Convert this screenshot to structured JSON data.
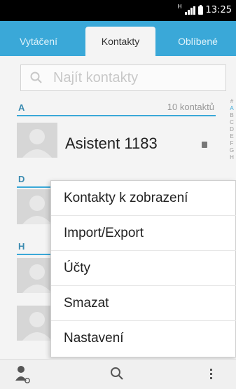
{
  "status_bar": {
    "network": "H",
    "time": "13:25"
  },
  "tabs": [
    {
      "label": "Vytáčení",
      "active": false
    },
    {
      "label": "Kontakty",
      "active": true
    },
    {
      "label": "Oblíbené",
      "active": false
    }
  ],
  "search": {
    "placeholder": "Najít kontakty",
    "icon": "search-icon"
  },
  "sections": [
    {
      "letter": "A",
      "count": "10 kontaktů"
    },
    {
      "letter": "D",
      "count": ""
    },
    {
      "letter": "H",
      "count": ""
    }
  ],
  "contacts": [
    {
      "name": "Asistent 1183"
    }
  ],
  "index_bar": [
    "#",
    "A",
    "B",
    "C",
    "D",
    "E",
    "F",
    "G",
    "H"
  ],
  "menu": {
    "items": [
      "Kontakty k zobrazení",
      "Import/Export",
      "Účty",
      "Smazat",
      "Nastavení"
    ]
  },
  "bottom_bar": {
    "icons": [
      "add-contact-icon",
      "search-icon",
      "more-options-icon"
    ]
  },
  "colors": {
    "accent": "#3aa8d8",
    "status_bar": "#000000"
  }
}
